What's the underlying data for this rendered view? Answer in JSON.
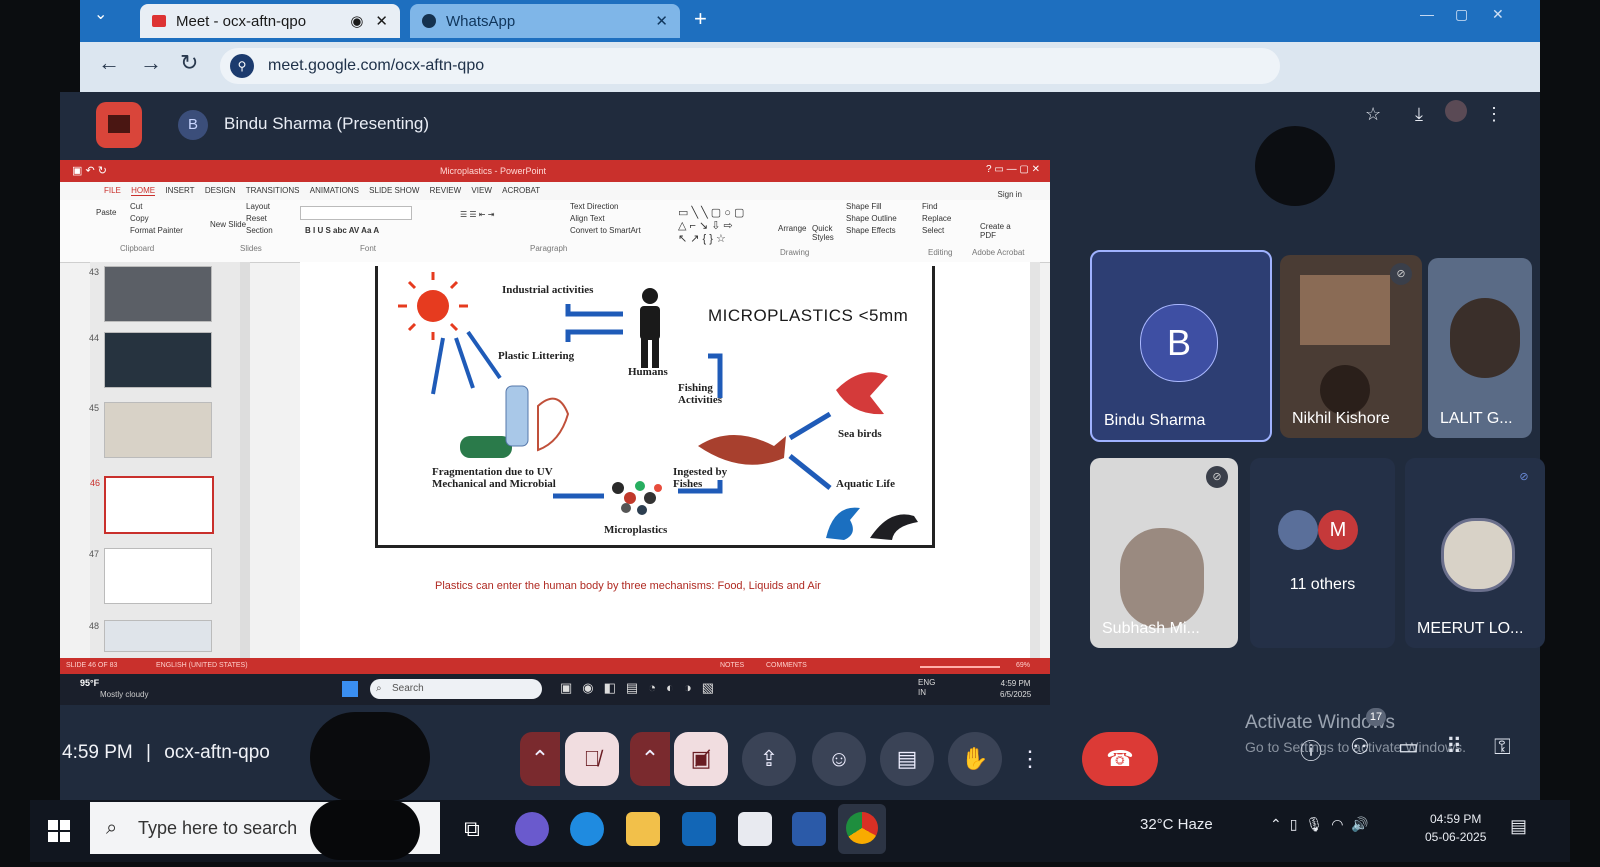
{
  "browser": {
    "tabs": [
      {
        "label": "Meet - ocx-aftn-qpo"
      },
      {
        "label": "WhatsApp"
      }
    ],
    "new_tab": "+",
    "url": "meet.google.com/ocx-aftn-qpo"
  },
  "meet": {
    "presenter_initial": "B",
    "presenter_title": "Bindu Sharma (Presenting)",
    "participants": [
      {
        "name": "Bindu Sharma",
        "initial": "B"
      },
      {
        "name": "Nikhil Kishore"
      },
      {
        "name": "LALIT G..."
      },
      {
        "name": "Subhash Mi..."
      },
      {
        "name": "11 others",
        "initial": "M"
      },
      {
        "name": "MEERUT LO..."
      }
    ],
    "time": "4:59 PM",
    "separator": "|",
    "meeting_code": "ocx-aftn-qpo",
    "activate_title": "Activate Windows",
    "activate_sub": "Go to Settings to activate Windows.",
    "badge_count": "17"
  },
  "ppt": {
    "title_bar": "Microplastics - PowerPoint",
    "tabs": [
      "FILE",
      "HOME",
      "INSERT",
      "DESIGN",
      "TRANSITIONS",
      "ANIMATIONS",
      "SLIDE SHOW",
      "REVIEW",
      "VIEW",
      "ACROBAT"
    ],
    "ribbon": {
      "paste": "Paste",
      "cut": "Cut",
      "copy": "Copy",
      "format_painter": "Format Painter",
      "clipboard": "Clipboard",
      "new_slide": "New Slide",
      "layout": "Layout",
      "reset": "Reset",
      "section": "Section",
      "slides": "Slides",
      "font": "Font",
      "paragraph": "Paragraph",
      "text_direction": "Text Direction",
      "align_text": "Align Text",
      "convert_smartart": "Convert to SmartArt",
      "drawing": "Drawing",
      "arrange": "Arrange",
      "quick_styles": "Quick Styles",
      "shape_fill": "Shape Fill",
      "shape_outline": "Shape Outline",
      "shape_effects": "Shape Effects",
      "find": "Find",
      "replace": "Replace",
      "select": "Select",
      "editing": "Editing",
      "create_pdf": "Create a PDF",
      "adobe_acrobat": "Adobe Acrobat",
      "sign_in": "Sign in"
    },
    "thumbnails": [
      "43",
      "44",
      "45",
      "46",
      "47",
      "48"
    ],
    "slide": {
      "title": "MICROPLASTICS <5mm",
      "labels": {
        "industrial": "Industrial activities",
        "humans": "Humans",
        "littering": "Plastic Littering",
        "fishing": "Fishing Activities",
        "sea_birds": "Sea birds",
        "aquatic": "Aquatic Life",
        "fragmentation": "Fragmentation due to UV Mechanical and Microbial",
        "ingested": "Ingested by Fishes",
        "microplastics": "Microplastics"
      },
      "caption": "Plastics can enter the human body by three mechanisms: Food, Liquids and Air"
    },
    "status": {
      "slide_of": "SLIDE 46 OF 83",
      "language": "ENGLISH (UNITED STATES)",
      "notes": "NOTES",
      "comments": "COMMENTS",
      "zoom": "69%"
    },
    "small_taskbar": {
      "weather_temp": "95°F",
      "weather_desc": "Mostly cloudy",
      "search": "Search",
      "lang": "ENG",
      "region": "IN",
      "time": "4:59 PM",
      "date": "6/5/2025"
    }
  },
  "taskbar": {
    "search_placeholder": "Type here to search",
    "weather": "32°C  Haze",
    "time": "04:59 PM",
    "date": "05-06-2025"
  },
  "colors": {
    "meet_bg": "#202b3d",
    "end_call": "#dc3a36",
    "ppt_red": "#c9302c",
    "presenting_tile": "#2d3e73"
  }
}
